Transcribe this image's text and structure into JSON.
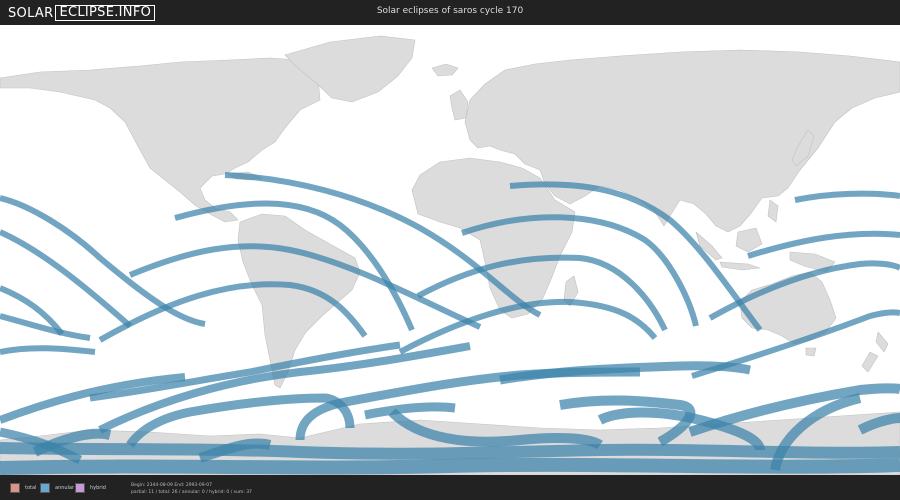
{
  "header": {
    "logo_left": "SOLAR",
    "logo_right": "ECLIPSE.INFO",
    "title": "Solar eclipses of saros cycle 170"
  },
  "legend": [
    {
      "label": "total",
      "color": "#d9938a"
    },
    {
      "label": "annular",
      "color": "#6aa7cf"
    },
    {
      "label": "hybrid",
      "color": "#c79ad6"
    }
  ],
  "stats": {
    "line1": "Begin: 2344-08-09 End: 2993-09-07",
    "line2": "partial: 11 / total: 26 / annular: 0 / hybrid: 0 / sum: 37"
  },
  "colors": {
    "bar": "#222222",
    "land": "#dcdcdc",
    "land_border": "#c2c2c2",
    "ocean": "#ffffff",
    "path": "#3b82ab"
  }
}
